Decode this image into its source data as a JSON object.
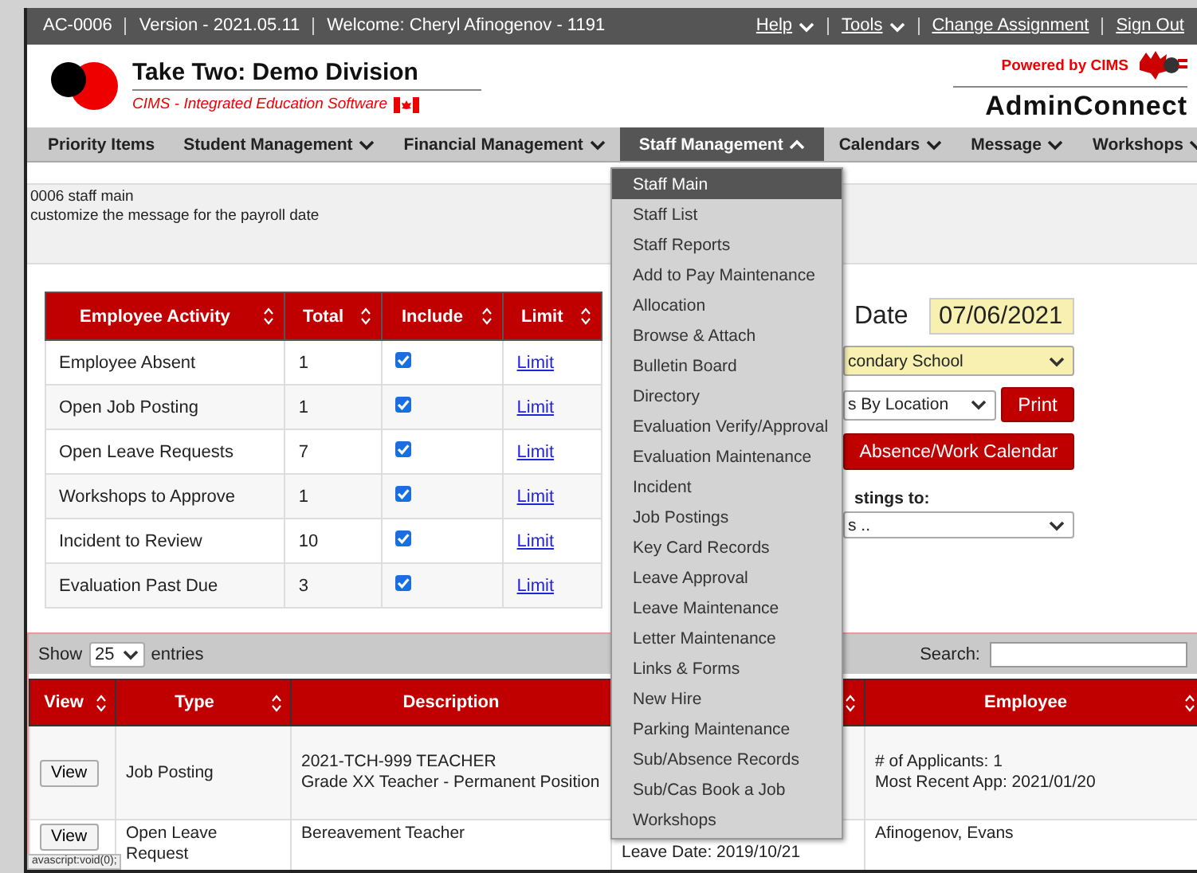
{
  "top_bar": {
    "info": [
      "AC-0006",
      "Version - 2021.05.11",
      "Welcome: Cheryl Afinogenov - 1191"
    ],
    "links": [
      {
        "label": "Help",
        "dropdown": true
      },
      {
        "label": "Tools",
        "dropdown": true
      },
      {
        "label": "Change Assignment",
        "dropdown": false
      },
      {
        "label": "Sign Out",
        "dropdown": false
      }
    ]
  },
  "header": {
    "title": "Take Two: Demo Division",
    "subtitle": "CIMS - Integrated Education Software",
    "powered_by": "Powered by CIMS",
    "product": "AdminConnect"
  },
  "nav": [
    {
      "label": "Priority Items",
      "dropdown": false,
      "selected": false
    },
    {
      "label": "Student Management",
      "dropdown": true,
      "selected": false,
      "expanded": false
    },
    {
      "label": "Financial Management",
      "dropdown": true,
      "selected": false,
      "expanded": false
    },
    {
      "label": "Staff Management",
      "dropdown": true,
      "selected": true,
      "expanded": true
    },
    {
      "label": "Calendars",
      "dropdown": true,
      "selected": false,
      "expanded": false
    },
    {
      "label": "Message",
      "dropdown": true,
      "selected": false,
      "expanded": false
    },
    {
      "label": "Workshops",
      "dropdown": true,
      "selected": false,
      "expanded": false
    }
  ],
  "staff_menu": [
    {
      "label": "Staff Main",
      "selected": true
    },
    {
      "label": "Staff List",
      "selected": false
    },
    {
      "label": "Staff Reports",
      "selected": false
    },
    {
      "label": "Add to Pay Maintenance",
      "selected": false
    },
    {
      "label": "Allocation",
      "selected": false
    },
    {
      "label": "Browse & Attach",
      "selected": false
    },
    {
      "label": "Bulletin Board",
      "selected": false
    },
    {
      "label": "Directory",
      "selected": false
    },
    {
      "label": "Evaluation Verify/Approval",
      "selected": false
    },
    {
      "label": "Evaluation Maintenance",
      "selected": false
    },
    {
      "label": "Incident",
      "selected": false
    },
    {
      "label": "Job Postings",
      "selected": false
    },
    {
      "label": "Key Card Records",
      "selected": false
    },
    {
      "label": "Leave Approval",
      "selected": false
    },
    {
      "label": "Leave Maintenance",
      "selected": false
    },
    {
      "label": "Letter Maintenance",
      "selected": false
    },
    {
      "label": "Links & Forms",
      "selected": false
    },
    {
      "label": "New Hire",
      "selected": false
    },
    {
      "label": "Parking Maintenance",
      "selected": false
    },
    {
      "label": "Sub/Absence Records",
      "selected": false
    },
    {
      "label": "Sub/Cas Book a Job",
      "selected": false
    },
    {
      "label": "Workshops",
      "selected": false
    }
  ],
  "message": [
    "0006 staff main",
    "customize the message for the payroll date"
  ],
  "activity_table": {
    "columns": [
      "Employee Activity",
      "Total",
      "Include",
      "Limit"
    ],
    "rows": [
      {
        "activity": "Employee Absent",
        "total": "1",
        "include": true,
        "limit": "Limit"
      },
      {
        "activity": "Open Job Posting",
        "total": "1",
        "include": true,
        "limit": "Limit"
      },
      {
        "activity": "Open Leave Requests",
        "total": "7",
        "include": true,
        "limit": "Limit"
      },
      {
        "activity": "Workshops to Approve",
        "total": "1",
        "include": true,
        "limit": "Limit"
      },
      {
        "activity": "Incident to Review",
        "total": "10",
        "include": true,
        "limit": "Limit"
      },
      {
        "activity": "Evaluation Past Due",
        "total": "3",
        "include": true,
        "limit": "Limit"
      }
    ]
  },
  "side_form": {
    "date_label": "Date",
    "date_value": "07/06/2021",
    "school_select": "condary School",
    "report_select": "s By Location",
    "print_button": "Print",
    "calendar_button": "Absence/Work Calendar",
    "postings_label": "stings to:",
    "postings_select": "s .."
  },
  "data_table": {
    "show_label": "Show",
    "page_size": "25",
    "entries_label": "entries",
    "search_label": "Search:",
    "columns": [
      {
        "label": "View",
        "sortable": true
      },
      {
        "label": "Type",
        "sortable": true
      },
      {
        "label": "Description",
        "sortable": false
      },
      {
        "sortable": true
      },
      {
        "label": "Employee",
        "sortable": true
      }
    ],
    "rows": [
      {
        "view": "View",
        "type": "Job Posting",
        "description": [
          "2021-TCH-999 TEACHER",
          "Grade XX Teacher - Permanent Position"
        ],
        "employee": [
          "# of Applicants: 1",
          "Most Recent App: 2021/01/20"
        ]
      },
      {
        "view": "View",
        "type": "Open Leave Request",
        "description": [
          "Bereavement Teacher"
        ],
        "column_4": [
          "Leave Date: 2019/10/21"
        ],
        "employee": [
          "Afinogenov, Evans"
        ]
      }
    ]
  },
  "status_text": "avascript:void(0);"
}
